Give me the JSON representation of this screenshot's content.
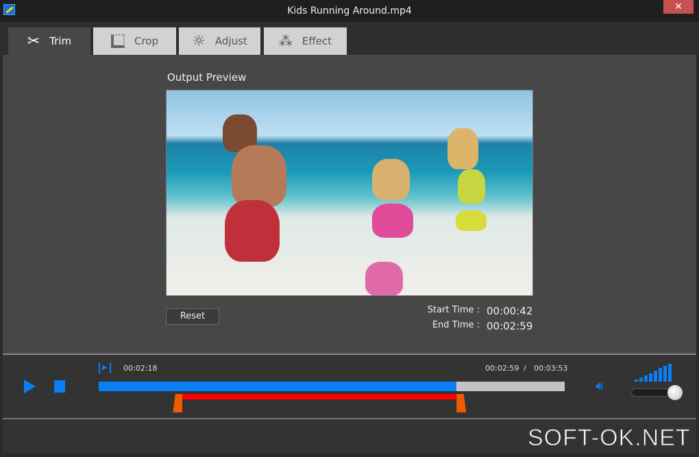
{
  "window": {
    "title": "Kids Running Around.mp4",
    "close_label": "✕"
  },
  "tabs": [
    {
      "label": "Trim",
      "icon": "scissors-icon",
      "active": true
    },
    {
      "label": "Crop",
      "icon": "crop-icon",
      "active": false
    },
    {
      "label": "Adjust",
      "icon": "brightness-icon",
      "active": false
    },
    {
      "label": "Effect",
      "icon": "magic-wand-icon",
      "active": false
    }
  ],
  "preview": {
    "label": "Output Preview"
  },
  "reset_label": "Reset",
  "trim": {
    "start_label": "Start Time :",
    "start_value": "00:00:42",
    "end_label": "End Time :",
    "end_value": "00:02:59"
  },
  "player": {
    "current_time": "00:02:18",
    "position_time": "00:02:59",
    "separator": "/",
    "total_time": "00:03:53",
    "progress_fraction": 0.768,
    "trim_start_fraction": 0.18,
    "trim_end_fraction": 0.768,
    "volume_fraction": 0.85
  },
  "watermark": "SOFT-OK.NET",
  "colors": {
    "accent": "#0a7ef5",
    "trim_range": "#ff0000",
    "handle": "#f05a00"
  }
}
